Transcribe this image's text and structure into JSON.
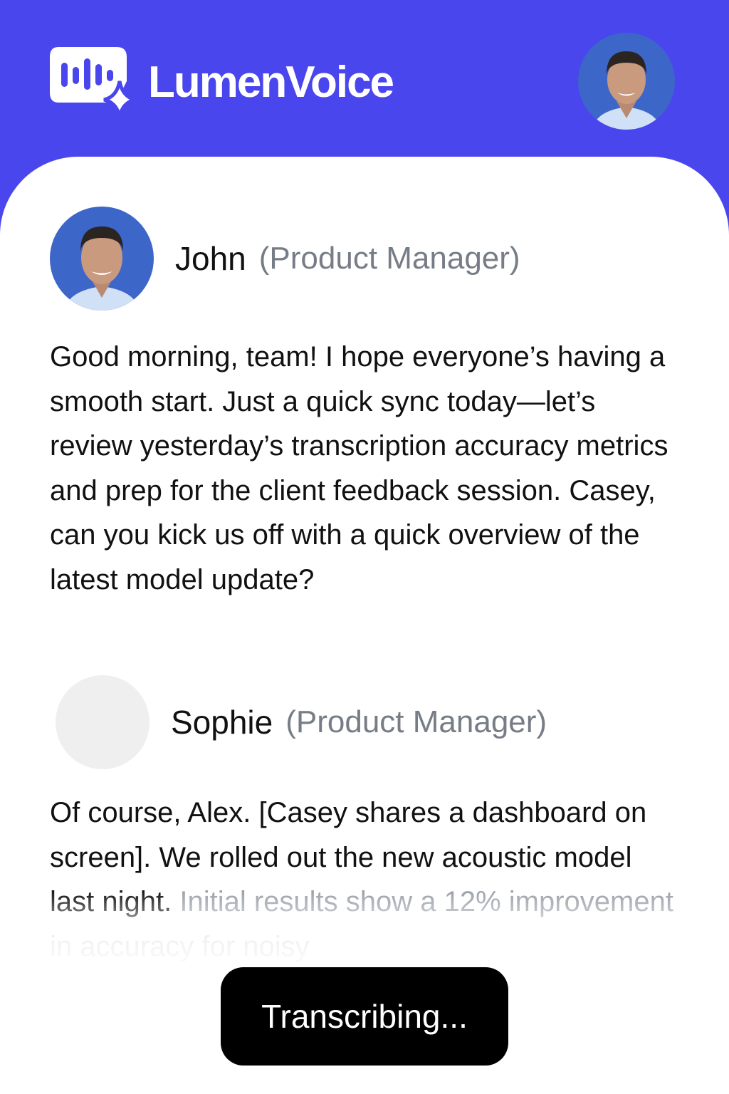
{
  "app": {
    "name": "LumenVoice",
    "brand_color": "#4A46EE",
    "logo_icon": "waveform-sparkle-icon"
  },
  "header": {
    "profile_avatar": "profile-avatar-john"
  },
  "transcript": [
    {
      "speaker": "John",
      "role": "(Product Manager)",
      "avatar": "avatar-john-photo",
      "text": "Good morning, team! I hope everyone’s having a smooth start. Just a quick sync today—let’s review yesterday’s transcription accuracy metrics and prep for the client feedback session. Casey, can you kick us off with a quick overview of the latest model update?"
    },
    {
      "speaker": "Sophie",
      "role": "(Product Manager)",
      "avatar": "avatar-placeholder",
      "text": "Of course, Alex. [Casey shares a dashboard on screen]. We rolled out the new acoustic model last night.",
      "text_partial": " Initial results show a 12% improvement in accuracy for noisy"
    }
  ],
  "status_button": {
    "label": "Transcribing..."
  }
}
